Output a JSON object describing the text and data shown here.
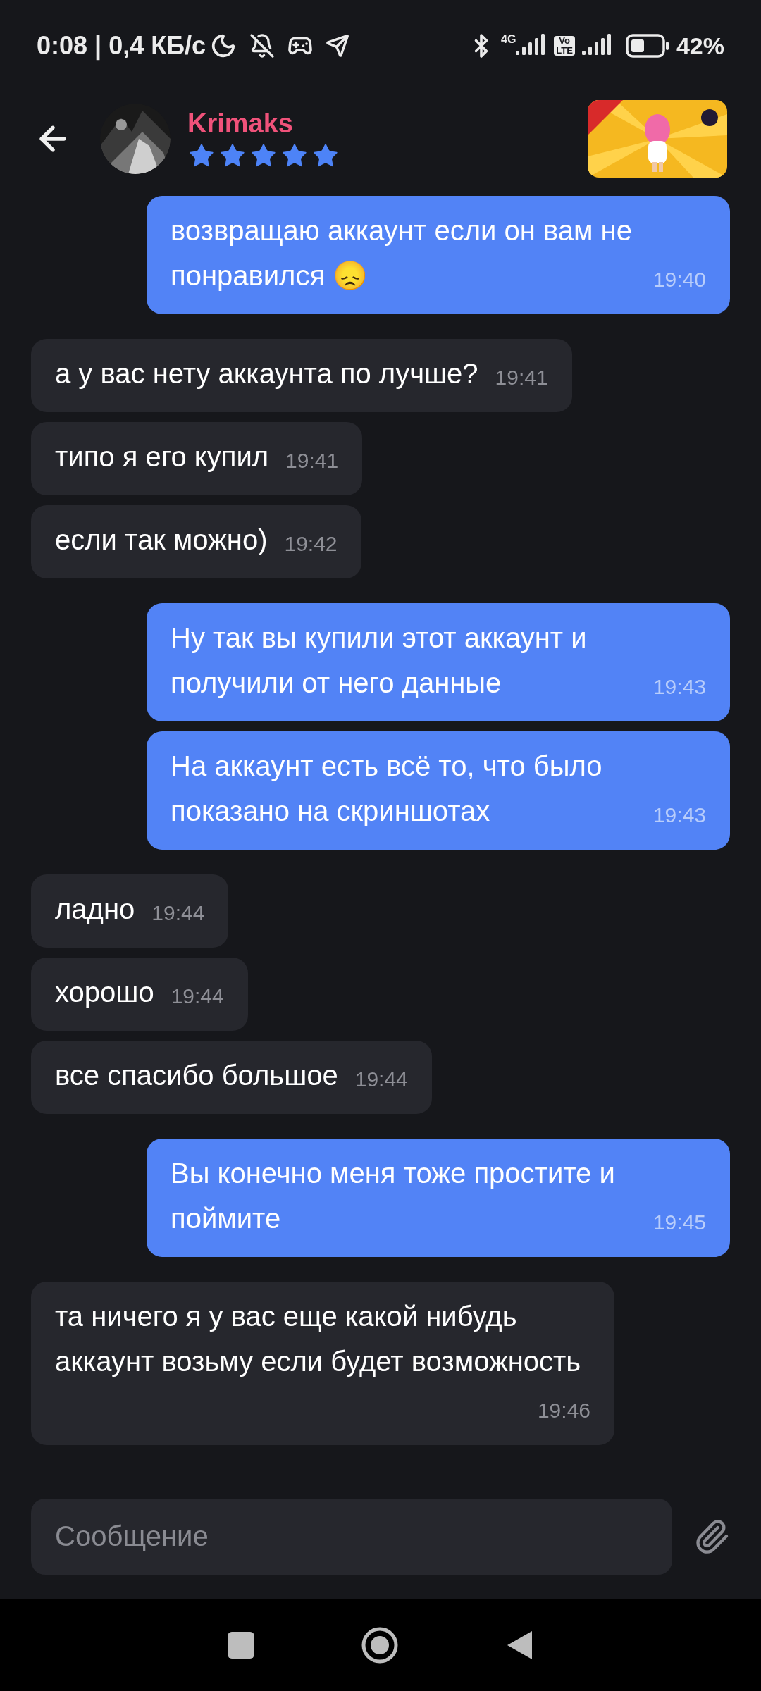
{
  "status_bar": {
    "time_speed": "0:08 | 0,4 КБ/с",
    "network": "4G",
    "volte_top": "Vo",
    "volte_bottom": "LTE",
    "battery": "42%"
  },
  "header": {
    "name": "Krimaks",
    "stars": 5
  },
  "messages": [
    {
      "kind": "out",
      "text": "возвращаю аккаунт если он вам не понравился 😞",
      "time": "19:40"
    },
    {
      "kind": "in",
      "text": "а у вас нету аккаунта по лучше?",
      "time": "19:41"
    },
    {
      "kind": "in",
      "text": "типо я его купил",
      "time": "19:41"
    },
    {
      "kind": "in",
      "text": "если так можно)",
      "time": "19:42"
    },
    {
      "kind": "out",
      "text": "Ну так вы купили этот аккаунт и получили от него данные",
      "time": "19:43"
    },
    {
      "kind": "out",
      "text": "На аккаунт есть всё то, что было показано на скриншотах",
      "time": "19:43"
    },
    {
      "kind": "in",
      "text": "ладно",
      "time": "19:44"
    },
    {
      "kind": "in",
      "text": "хорошо",
      "time": "19:44"
    },
    {
      "kind": "in",
      "text": "все спасибо большое",
      "time": "19:44"
    },
    {
      "kind": "out",
      "text": "Вы конечно меня тоже простите и поймите",
      "time": "19:45"
    },
    {
      "kind": "in",
      "text": "та ничего я у вас еще какой нибудь аккаунт возьму если будет возможность",
      "time": "19:46"
    }
  ],
  "composer": {
    "placeholder": "Сообщение"
  }
}
